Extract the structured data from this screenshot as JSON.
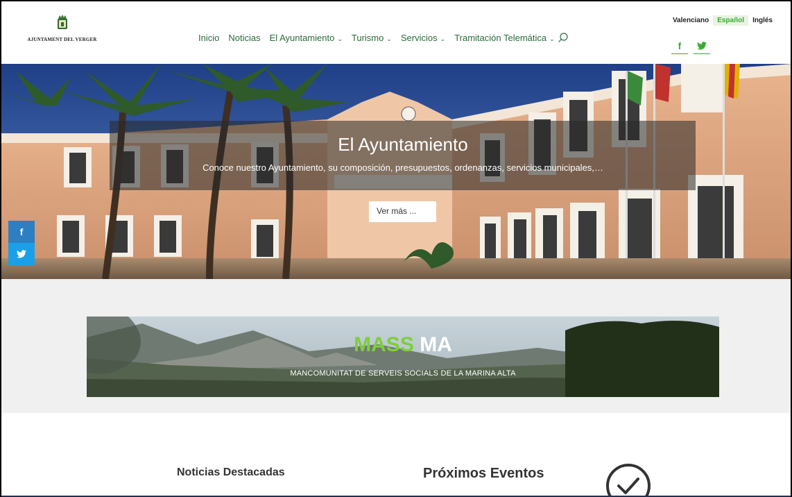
{
  "header": {
    "logo_text": "AJUNTAMENT DEL VERGER",
    "nav": [
      {
        "label": "Inicio",
        "dropdown": false
      },
      {
        "label": "Noticias",
        "dropdown": false
      },
      {
        "label": "El Ayuntamiento",
        "dropdown": true
      },
      {
        "label": "Turismo",
        "dropdown": true
      },
      {
        "label": "Servicios",
        "dropdown": true
      },
      {
        "label": "Tramitación Telemática",
        "dropdown": true
      }
    ],
    "search_icon": "search-icon",
    "languages": [
      "Valenciano",
      "Español",
      "Inglés"
    ],
    "active_language": "Español",
    "social": {
      "facebook": "f",
      "twitter": "twitter-bird-icon"
    }
  },
  "hero": {
    "title": "El Ayuntamiento",
    "subtitle": "Conoce nuestro Ayuntamiento, su composición, presupuestos, ordenanzas, servicios municipales,…",
    "button_label": "Ver más ..."
  },
  "side_social": {
    "facebook": "f",
    "twitter": "twitter-bird-icon"
  },
  "banner": {
    "brand_green": "MASS",
    "brand_white": "MA",
    "tagline": "MANCOMUNITAT DE SERVEIS SOCIALS DE LA MARINA ALTA"
  },
  "sections": {
    "news_title": "Noticias Destacadas",
    "events_title": "Próximos Eventos",
    "events_icon": "clock-check-icon"
  },
  "colors": {
    "accent_green": "#3aaa35",
    "nav_text": "#2d6a3a",
    "facebook_blue": "#2d7fc1",
    "twitter_blue": "#1aa0e8",
    "footer_bar": "#21304d"
  }
}
